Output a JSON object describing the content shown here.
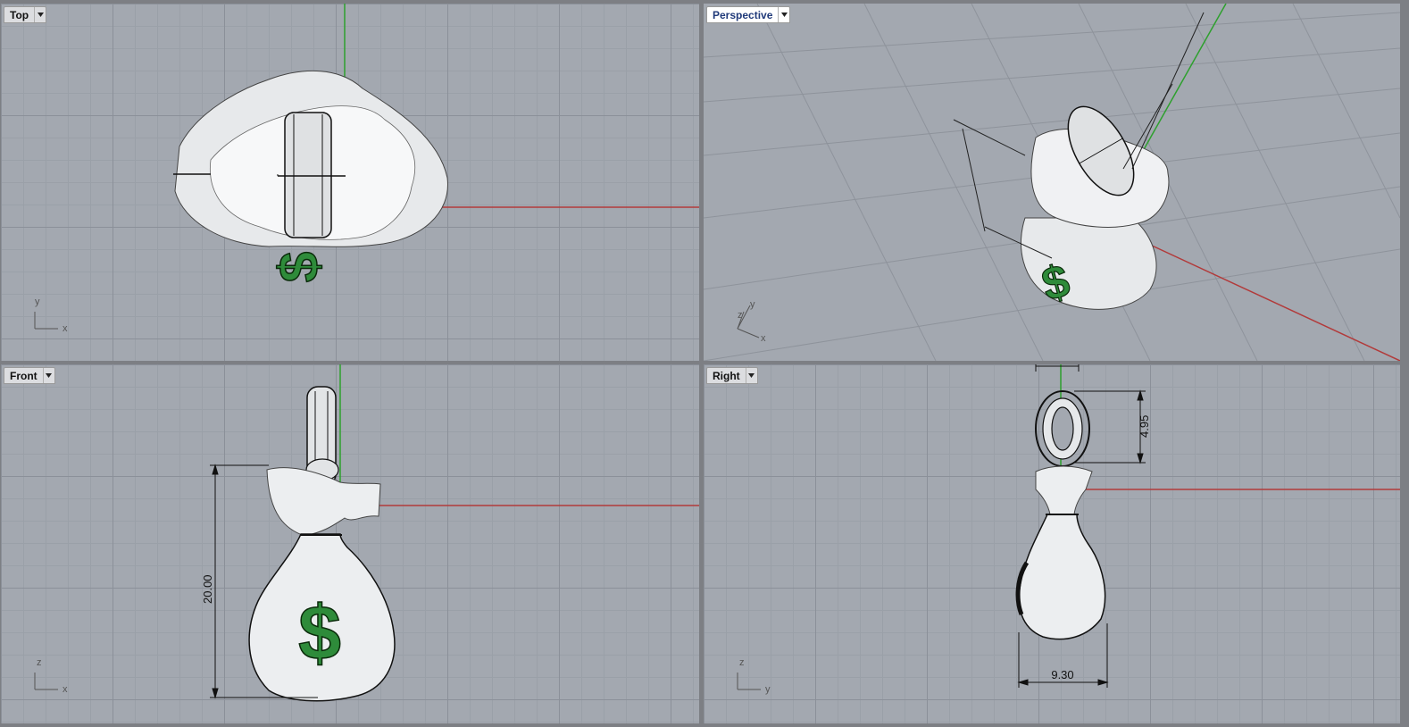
{
  "viewports": {
    "top": {
      "title": "Top",
      "axis_labels": [
        "y",
        "x"
      ]
    },
    "perspective": {
      "title": "Perspective",
      "axis_labels": [
        "z",
        "y",
        "x"
      ]
    },
    "front": {
      "title": "Front",
      "axis_labels": [
        "z",
        "x"
      ]
    },
    "right": {
      "title": "Right",
      "axis_labels": [
        "z",
        "y"
      ]
    }
  },
  "dimensions": {
    "front_height": "20.00",
    "right_loop_height": "4.95",
    "right_width": "9.30"
  },
  "colors": {
    "viewport_bg": "#a3a8b0",
    "x_axis": "#b23a3a",
    "y_axis": "#2ea02e",
    "model": "#eceef0",
    "dollar_sign": "#2e8b3a"
  },
  "icons": {
    "viewport_menu": "chevron-down-icon"
  }
}
